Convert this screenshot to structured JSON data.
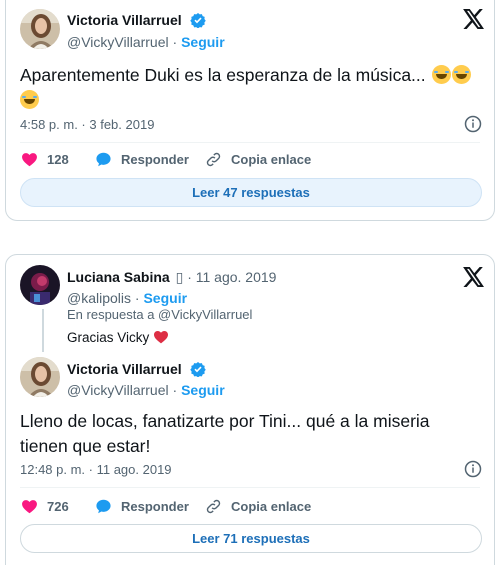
{
  "tweet1": {
    "author_name": "Victoria Villarruel",
    "handle": "@VickyVillarruel",
    "separator": " · ",
    "follow_label": "Seguir",
    "text": "Aparentemente Duki es la esperanza de la música...",
    "emoji_name": "rolling-on-floor-laughing",
    "timestamp": "4:58 p. m. · 3 feb. 2019",
    "likes": "128",
    "reply_label": "Responder",
    "copy_label": "Copia enlace",
    "read_replies_label": "Leer 47 respuestas"
  },
  "tweet2": {
    "parent": {
      "author_name": "Luciana Sabina",
      "name_suffix": "▯ · 11 ago. 2019",
      "handle": "@kalipolis",
      "separator": " · ",
      "follow_label": "Seguir",
      "reply_to": "En respuesta a @VickyVillarruel",
      "text": "Gracias Vicky"
    },
    "author_name": "Victoria Villarruel",
    "handle": "@VickyVillarruel",
    "separator": " · ",
    "follow_label": "Seguir",
    "text": "Lleno de locas, fanatizarte por Tini... qué a la miseria tienen que estar!",
    "timestamp": "12:48 p. m. · 11 ago. 2019",
    "likes": "726",
    "reply_label": "Responder",
    "copy_label": "Copia enlace",
    "read_replies_label": "Leer 71 respuestas"
  },
  "colors": {
    "accent": "#1d9bf0",
    "heart": "#f91880",
    "verified": "#1d9bf0",
    "muted": "#536471"
  }
}
